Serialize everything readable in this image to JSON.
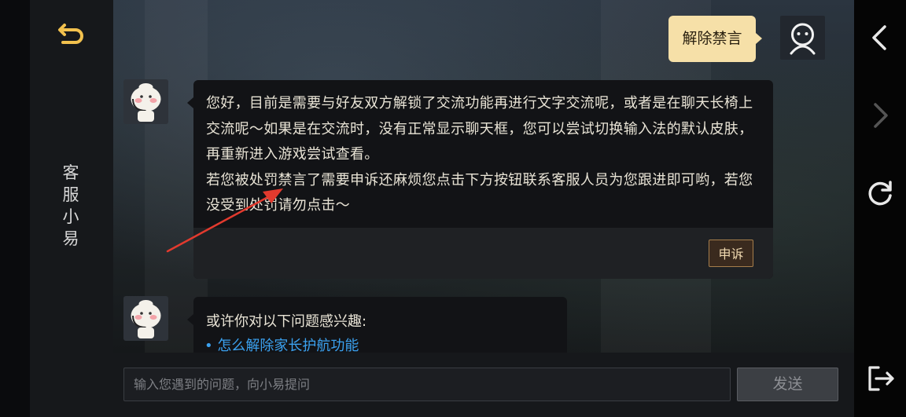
{
  "sidebar": {
    "title_chars": [
      "客",
      "服",
      "小",
      "易"
    ]
  },
  "user_message": {
    "text": "解除禁言"
  },
  "bot_message_1": {
    "para1": "您好，目前是需要与好友双方解锁了交流功能再进行文字交流呢，或者是在聊天长椅上交流呢～如果是在交流时，没有正常显示聊天框，您可以尝试切换输入法的默认皮肤，再重新进入游戏尝试查看。",
    "para2": "若您被处罚禁言了需要申诉还麻烦您点击下方按钮联系客服人员为您跟进即可哟，若您没受到处罚请勿点击～",
    "appeal_label": "申诉"
  },
  "bot_message_2": {
    "intro": "或许你对以下问题感兴趣:",
    "link": "• 怎么解除家长护航功能"
  },
  "input": {
    "placeholder": "输入您遇到的问题，向小易提问",
    "value": ""
  },
  "send_label": "发送",
  "colors": {
    "accent_gold": "#f6e0a8",
    "link_blue": "#3ba1ef",
    "appeal_border": "#a67e4c",
    "annotation_red": "#e23a2e"
  },
  "icons": [
    "back-arrow-icon",
    "user-avatar-icon",
    "bot-avatar-icon",
    "chevron-left-icon",
    "chevron-right-icon",
    "refresh-icon",
    "exit-icon",
    "annotation-arrow"
  ]
}
